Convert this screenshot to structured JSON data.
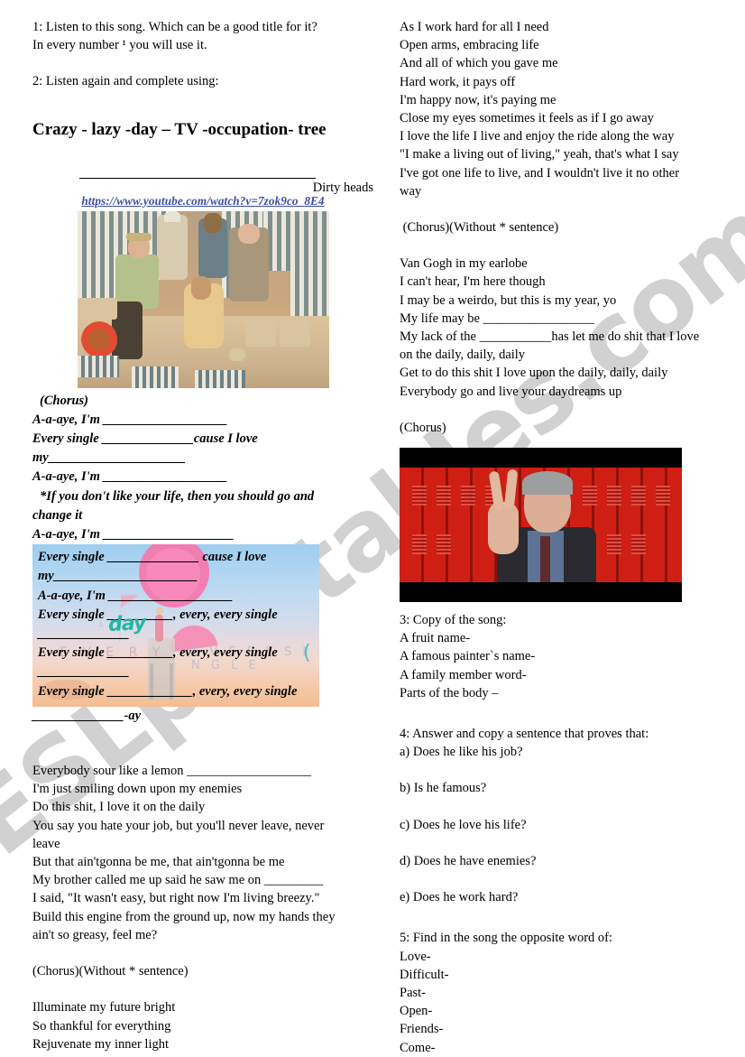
{
  "watermark": {
    "text": "ESLprintables.com"
  },
  "left_column": {
    "task1": [
      "1: Listen to this song. Which can be a good title for it?",
      "In every number ¹ you will use it."
    ],
    "task2": "2: Listen again and complete using:",
    "word_bank": "Crazy - lazy -day – TV -occupation- tree",
    "artist": "Dirty heads",
    "url": "https://www.youtube.com/watch?v=7zok9co_8E4",
    "photo1_caption": "dirty-heads-band-beach-cabana-photo",
    "chorus_label": "(Chorus)",
    "chorus_lines": [
      "A-a-aye, I'm ___________________",
      "Every single ______________cause I love",
      "my_____________________",
      "A-a-aye, I'm ___________________",
      "*If you don't like your life, then you should go and",
      "change it",
      "A-a-aye, I'm ____________________"
    ],
    "beach_box_lines": [
      "Every single ______________ cause I love",
      "my______________________",
      "A-a-aye, I'm ___________________",
      "Every single __________, every, every single",
      "______________",
      "Every single __________, every, every single",
      "______________",
      "Every single _____________, every, every single"
    ],
    "beach_box_handwriting": "day",
    "beach_box_ghost": {
      "every": "E V E R Y",
      "every_single": "E V E R Y   S I N G L E",
      "le": "L E",
      "paren": "("
    },
    "after_box_line": "______________-ay",
    "verse2": [
      "Everybody sour like a lemon ___________________",
      "I'm just smiling down upon my enemies",
      "Do this shit, I love it on the daily",
      "You say you hate your job, but you'll never leave, never",
      "leave",
      "But that ain'tgonna be me, that ain'tgonna be me",
      "My brother called me up said he saw me on _________",
      "I said, \"It wasn't easy, but right now I'm living breezy.\"",
      "Build this engine from the ground up, now my hands they",
      "ain't so greasy, feel me?"
    ],
    "chorus_ref": "(Chorus)(Without * sentence)",
    "verse3": [
      "Illuminate my future bright",
      "So thankful for everything",
      "Rejuvenate my inner light"
    ]
  },
  "right_column": {
    "verse_top": [
      "As I work hard for all I need",
      "Open arms, embracing life",
      "And all of which you gave me",
      "Hard work, it pays off",
      "I'm happy now, it's paying me",
      "Close my eyes sometimes it feels as if I go away",
      "I love the life I live and enjoy the ride along the way",
      "\"I make a living out of living,\" yeah, that's what I say",
      "I've got one life to live, and I wouldn't live it no other",
      "way"
    ],
    "chorus_ref_1": " (Chorus)(Without * sentence)",
    "verse_vangogh": [
      "Van Gogh in my earlobe",
      "I can't hear, I'm here though",
      "I may be a weirdo, but this is my year, yo",
      "My life may be _________________",
      "My lack of the ___________has let me do shit that I love",
      "on the daily, daily, daily",
      "Get to do this shit I love upon the daily, daily, daily",
      "Everybody go and live your daydreams up"
    ],
    "chorus_ref_2": "(Chorus)",
    "photo2_caption": "man-peace-sign-red-lockers-photo",
    "task3_title": "3: Copy of the song:",
    "task3_items": [
      "A fruit name-",
      "A famous painter`s name-",
      "A family member word-",
      "Parts of the body –"
    ],
    "task4_title": "4: Answer and copy a sentence that proves that:",
    "task4_items": [
      "a) Does he like his job?",
      "b) Is he famous?",
      "c) Does he love his life?",
      "d) Does he have enemies?",
      "e) Does he work hard?"
    ],
    "task5_title": "5: Find in the song the opposite word of:",
    "task5_items": [
      "Love-",
      "Difficult-",
      "Past-",
      "Open-",
      "Friends-",
      "Come-"
    ]
  },
  "colors": {
    "link": "#3b4ea8",
    "handwriting": "#26b6a8",
    "locker_red": "#cf1f14",
    "watermark": "#c9c9c9"
  }
}
